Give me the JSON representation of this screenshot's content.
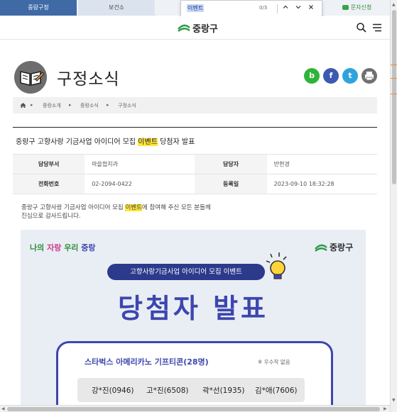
{
  "top_tabs": [
    {
      "label": "중랑구청"
    },
    {
      "label": "보건소"
    },
    {
      "label": ""
    },
    {
      "label": "문자신청"
    }
  ],
  "find_bar": {
    "query": "이벤트",
    "count": "0/3",
    "up_icon": "chevron-up-icon",
    "down_icon": "chevron-down-icon",
    "close_icon": "close-icon"
  },
  "header": {
    "logo_text": "중랑구",
    "search_icon": "search-icon",
    "menu_icon": "hamburger-menu-icon"
  },
  "page": {
    "title": "구정소식",
    "title_icon": "book-icon"
  },
  "share": [
    {
      "label": "b",
      "color": "#2fb33a",
      "icon": "blog-icon"
    },
    {
      "label": "f",
      "color": "#3b5ab0",
      "icon": "facebook-icon"
    },
    {
      "label": "t",
      "color": "#31a3dc",
      "icon": "twitter-icon"
    },
    {
      "label": "",
      "color": "#707070",
      "icon": "print-icon"
    }
  ],
  "breadcrumb": [
    "중랑소개",
    "중랑소식",
    "구정소식"
  ],
  "post": {
    "title_prefix": "중랑구 고향사랑 기금사업 아이디어 모집 ",
    "title_highlight": "이벤트",
    "title_suffix": " 당첨자 발표",
    "info": {
      "dept_label": "담당부서",
      "dept_value": "마을협치과",
      "writer_label": "담당자",
      "writer_value": "반현경",
      "phone_label": "전화번호",
      "phone_value": "02-2094-0422",
      "date_label": "등록일",
      "date_value": "2023-09-10 18:32:28"
    },
    "body_prefix": "중랑구 고향사랑 기금사업 아이디어 모집 ",
    "body_highlight": "이벤트",
    "body_suffix": "에 참여해 주신 모든 분들께",
    "body_line2": "진심으로 감사드립니다."
  },
  "promo": {
    "slogan_words": [
      {
        "text": "나의",
        "color": "#2d8f3a"
      },
      {
        "text": "자랑",
        "color": "#d03a8c"
      },
      {
        "text": "우리",
        "color": "#2d8f3a"
      },
      {
        "text": "중랑",
        "color": "#3d46ad"
      }
    ],
    "logo_text": "중랑구",
    "event_label": "고향사랑기금사업 아이디어 모집 이벤트",
    "big_title": "당첨자 발표",
    "prize_title": "스타벅스 아메리카노 기프티콘(28명)",
    "prize_note": "※ 우수작 없음",
    "winners": [
      "강*진(0946)",
      "고*진(6508)",
      "곽*선(1935)",
      "김*애(7606)"
    ]
  },
  "colors": {
    "accent": "#3f6aa6",
    "highlight": "#ffe63b",
    "promo_blue": "#3d46ad",
    "orange_mark": "#f08c36"
  }
}
